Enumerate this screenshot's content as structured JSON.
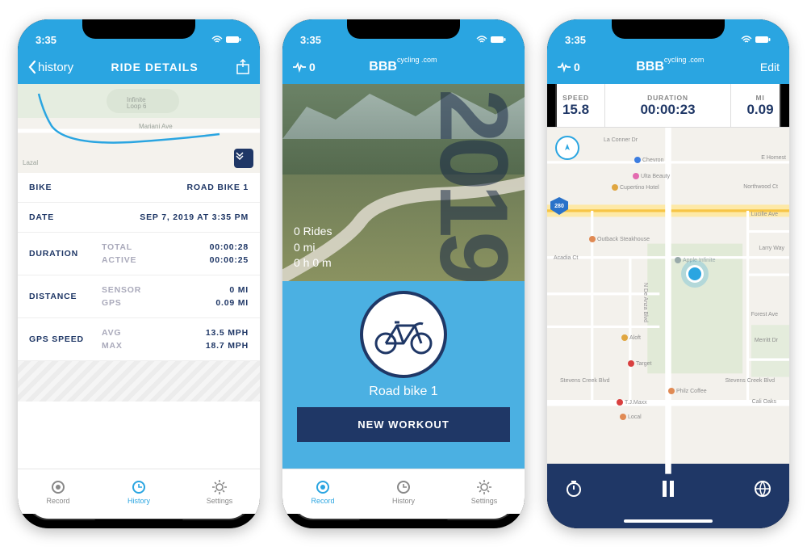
{
  "status": {
    "time": "3:35"
  },
  "screen1": {
    "back": "history",
    "title": "RIDE DETAILS",
    "map": {
      "place1": "Infinite Loop 6",
      "street1": "Mariani Ave",
      "street2": "Lazal"
    },
    "rows": {
      "bike": {
        "label": "BIKE",
        "value": "ROAD BIKE 1"
      },
      "date": {
        "label": "DATE",
        "value": "SEP 7, 2019 AT 3:35 PM"
      },
      "duration": {
        "label": "DURATION",
        "total_l": "TOTAL",
        "total_v": "00:00:28",
        "active_l": "ACTIVE",
        "active_v": "00:00:25"
      },
      "distance": {
        "label": "DISTANCE",
        "sensor_l": "SENSOR",
        "sensor_v": "0 MI",
        "gps_l": "GPS",
        "gps_v": "0.09 MI"
      },
      "speed": {
        "label": "GPS SPEED",
        "avg_l": "AVG",
        "avg_v": "13.5 MPH",
        "max_l": "MAX",
        "max_v": "18.7 MPH"
      }
    },
    "tab": {
      "record": "Record",
      "history": "History",
      "settings": "Settings"
    }
  },
  "screen2": {
    "hr": "0",
    "brand": "BBB",
    "brand_sub": "cycling .com",
    "hero": {
      "rides": "0 Rides",
      "miles": "0 mi",
      "time": "0 h 0 m",
      "year": "2019"
    },
    "bike_name": "Road bike 1",
    "new_workout": "NEW WORKOUT",
    "tab": {
      "record": "Record",
      "history": "History",
      "settings": "Settings"
    }
  },
  "screen3": {
    "hr": "0",
    "brand": "BBB",
    "brand_sub": "cycling .com",
    "edit": "Edit",
    "stats": {
      "speed_l": "SPEED",
      "speed_v": "15.8",
      "dur_l": "DURATION",
      "dur_v": "00:00:23",
      "mi_l": "MI",
      "mi_v": "0.09"
    },
    "pois": {
      "chevron": "Chevron",
      "ulta": "Ulta Beauty",
      "cupertino": "Cupertino Hotel",
      "outback": "Outback Steakhouse",
      "apple": "Apple Infinite",
      "deanza": "N De Anza Blvd",
      "aloft": "Aloft",
      "target": "Target",
      "philz": "Philz Coffee",
      "scb_l": "Stevens Creek Blvd",
      "scb_r": "Stevens Creek Blvd",
      "tjmaxx": "T.J.Maxx",
      "oaks": "Cali Oaks",
      "hwy": "280",
      "laconner": "La Conner Dr",
      "homes": "E Homest",
      "northwood": "Northwood Ct",
      "lucille": "Lucille Ave",
      "larry": "Larry Way",
      "acadia": "Acadia Ct",
      "forestr": "Forest Ave",
      "merritt": "Merritt Dr",
      "local": "Local"
    }
  }
}
